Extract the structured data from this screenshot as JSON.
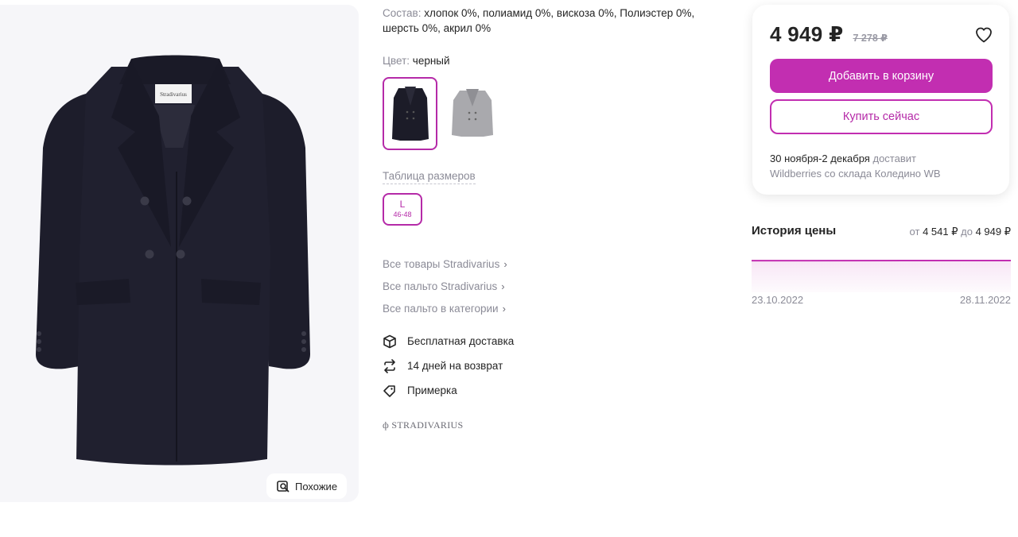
{
  "gallery": {
    "similar_label": "Похожие",
    "brand_tag": "Stradivarius"
  },
  "details": {
    "composition_label": "Состав:",
    "composition_value": "хлопок 0%, полиамид 0%, вискоза 0%, Полиэстер 0%, шерсть 0%, акрил 0%",
    "color_label": "Цвет:",
    "color_value": "черный",
    "swatches": [
      {
        "name": "черный",
        "selected": true,
        "color": "#1c1c28"
      },
      {
        "name": "серый",
        "selected": false,
        "color": "#a9a9ad"
      }
    ],
    "size_table_label": "Таблица размеров",
    "sizes": [
      {
        "label": "L",
        "ru": "46-48",
        "selected": true
      }
    ],
    "links": [
      {
        "label": "Все товары Stradivarius"
      },
      {
        "label": "Все пальто Stradivarius"
      },
      {
        "label": "Все пальто в категории"
      }
    ],
    "features": [
      {
        "label": "Бесплатная доставка",
        "icon": "box-icon"
      },
      {
        "label": "14 дней на возврат",
        "icon": "return-arrows-icon"
      },
      {
        "label": "Примерка",
        "icon": "tag-icon"
      }
    ],
    "brand_logo": "STRADIVARIUS"
  },
  "buy_card": {
    "price": "4 949 ₽",
    "old_price": "7 278 ₽",
    "add_to_cart_label": "Добавить в корзину",
    "buy_now_label": "Купить сейчас",
    "delivery_date": "30 ноября-2 декабря",
    "delivery_text": "доставит",
    "delivery_source": "Wildberries со склада Коледино WB",
    "accent_color": "#c22eb1"
  },
  "price_history": {
    "title": "История цены",
    "range_from_label": "от",
    "range_from": "4 541 ₽",
    "range_to_label": "до",
    "range_to": "4 949 ₽",
    "start_date": "23.10.2022",
    "end_date": "28.11.2022"
  },
  "chart_data": {
    "type": "area",
    "x": [
      "23.10.2022",
      "28.11.2022"
    ],
    "series": [
      {
        "values": [
          4541,
          4949
        ]
      }
    ],
    "ylim": [
      0,
      4949
    ],
    "grid": false
  }
}
